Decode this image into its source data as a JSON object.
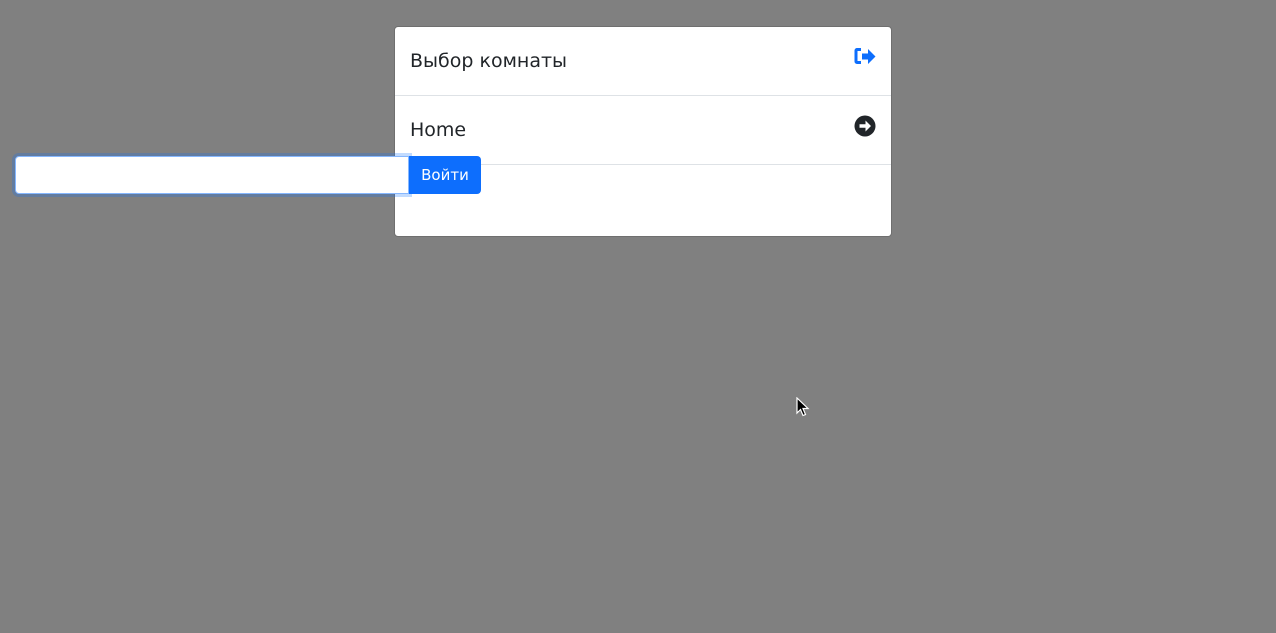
{
  "header": {
    "title": "Выбор комнаты",
    "icon": "sign-out-icon",
    "icon_color": "#0d6efd"
  },
  "rooms": [
    {
      "name": "Home",
      "icon": "arrow-circle-right-icon",
      "icon_color": "#212529"
    }
  ],
  "join": {
    "input_value": "",
    "input_placeholder": "",
    "button_label": "Войти",
    "button_color": "#0d6efd"
  },
  "background_color": "#808080"
}
